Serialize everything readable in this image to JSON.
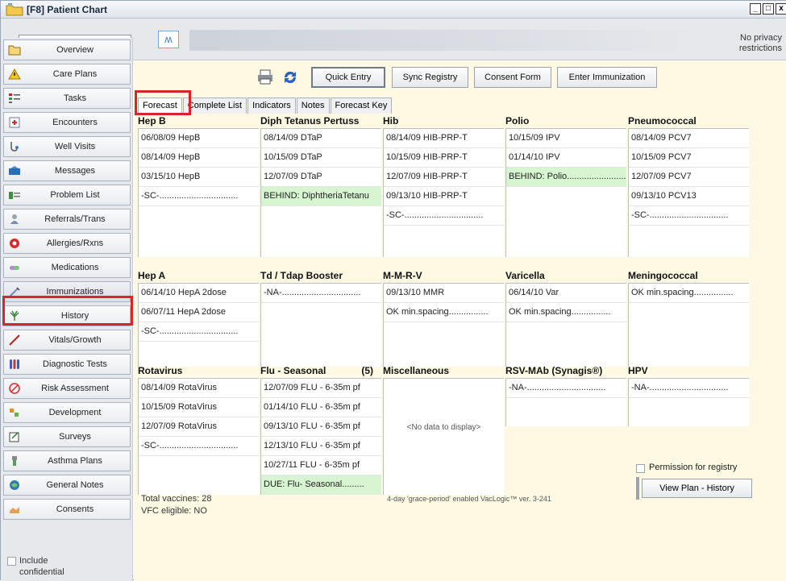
{
  "window": {
    "title": "[F8] Patient Chart",
    "controls": [
      "_",
      "□",
      "x"
    ]
  },
  "header": {
    "privacy_line1": "No privacy",
    "privacy_line2": "restrictions"
  },
  "sidebar": {
    "items": [
      {
        "label": "Overview",
        "icon": "folder-icon"
      },
      {
        "label": "Care Plans",
        "icon": "warning-icon"
      },
      {
        "label": "Tasks",
        "icon": "tasks-icon"
      },
      {
        "label": "Encounters",
        "icon": "encounters-icon"
      },
      {
        "label": "Well Visits",
        "icon": "well-visits-icon"
      },
      {
        "label": "Messages",
        "icon": "messages-icon"
      },
      {
        "label": "Problem List",
        "icon": "problem-list-icon"
      },
      {
        "label": "Referrals/Trans",
        "icon": "referrals-icon"
      },
      {
        "label": "Allergies/Rxns",
        "icon": "allergy-icon"
      },
      {
        "label": "Medications",
        "icon": "medications-icon"
      },
      {
        "label": "Immunizations",
        "icon": "syringe-icon"
      },
      {
        "label": "History",
        "icon": "history-icon"
      },
      {
        "label": "Vitals/Growth",
        "icon": "vitals-icon"
      },
      {
        "label": "Diagnostic Tests",
        "icon": "test-tubes-icon"
      },
      {
        "label": "Risk Assessment",
        "icon": "risk-icon"
      },
      {
        "label": "Development",
        "icon": "development-icon"
      },
      {
        "label": "Surveys",
        "icon": "surveys-icon"
      },
      {
        "label": "Asthma Plans",
        "icon": "asthma-icon"
      },
      {
        "label": "General Notes",
        "icon": "notes-icon"
      },
      {
        "label": "Consents",
        "icon": "consents-icon"
      }
    ],
    "selected": "Immunizations",
    "include_conf_line1": "Include",
    "include_conf_line2": "confidential"
  },
  "toolbar": {
    "quick_entry": "Quick Entry",
    "sync_registry": "Sync Registry",
    "consent_form": "Consent Form",
    "enter_immunization": "Enter Immunization"
  },
  "tabs": [
    "Forecast",
    "Complete List",
    "Indicators",
    "Notes",
    "Forecast Key"
  ],
  "active_tab": "Forecast",
  "vaccines": {
    "hepb": {
      "name": "Hep B",
      "rows": [
        "06/08/09  HepB",
        "08/14/09  HepB",
        "03/15/10  HepB",
        "-SC-................................"
      ]
    },
    "dtp": {
      "name": "Diph Tetanus Pertuss",
      "rows": [
        "08/14/09  DTaP",
        "10/15/09  DTaP",
        "12/07/09  DTaP",
        "BEHIND: DiphtheriaTetanu"
      ]
    },
    "hib": {
      "name": "Hib",
      "rows": [
        "08/14/09  HIB-PRP-T",
        "10/15/09  HIB-PRP-T",
        "12/07/09  HIB-PRP-T",
        "09/13/10  HIB-PRP-T",
        "-SC-................................"
      ]
    },
    "polio": {
      "name": "Polio",
      "rows": [
        "10/15/09  IPV",
        "01/14/10  IPV",
        "BEHIND: Polio........................"
      ]
    },
    "pneumo": {
      "name": "Pneumococcal",
      "rows": [
        "08/14/09  PCV7",
        "10/15/09  PCV7",
        "12/07/09  PCV7",
        "09/13/10  PCV13",
        "-SC-................................"
      ]
    },
    "hepa": {
      "name": "Hep A",
      "rows": [
        "06/14/10  HepA 2dose",
        "06/07/11  HepA 2dose",
        "-SC-................................"
      ]
    },
    "td": {
      "name": "Td / Tdap Booster",
      "rows": [
        "-NA-................................"
      ]
    },
    "mmr": {
      "name": "M-M-R-V",
      "rows": [
        "09/13/10  MMR",
        "OK min.spacing................"
      ]
    },
    "varicella": {
      "name": "Varicella",
      "rows": [
        "06/14/10  Var",
        "OK min.spacing................"
      ]
    },
    "mening": {
      "name": "Meningococcal",
      "rows": [
        "OK min.spacing................"
      ]
    },
    "rota": {
      "name": "Rotavirus",
      "rows": [
        "08/14/09  RotaVirus",
        "10/15/09  RotaVirus",
        "12/07/09  RotaVirus",
        "-SC-................................"
      ]
    },
    "flu": {
      "name": "Flu - Seasonal",
      "count": "(5)",
      "rows": [
        "12/07/09  FLU - 6-35m pf",
        "01/14/10  FLU - 6-35m pf",
        "09/13/10  FLU - 6-35m pf",
        "12/13/10  FLU - 6-35m pf",
        "10/27/11  FLU - 6-35m pf",
        "DUE: Flu- Seasonal........."
      ]
    },
    "misc": {
      "name": "Miscellaneous",
      "empty": "<No data to display>"
    },
    "rsv": {
      "name": "RSV-MAb (Synagis®)",
      "rows": [
        "-NA-................................"
      ]
    },
    "hpv": {
      "name": "HPV",
      "rows": [
        "-NA-................................"
      ]
    }
  },
  "footer": {
    "total_vaccines": "Total vaccines:  28",
    "vfc_eligible": "VFC eligible:  NO",
    "grace_period": "4-day 'grace-period' enabled   VacLogic™  ver. 3-241",
    "permission_label": "Permission for registry",
    "view_plan": "View Plan - History"
  },
  "colors": {
    "main_bg": "#fdf9e3",
    "behind_bg": "#d6f5d0",
    "highlight": "#d7262b"
  }
}
